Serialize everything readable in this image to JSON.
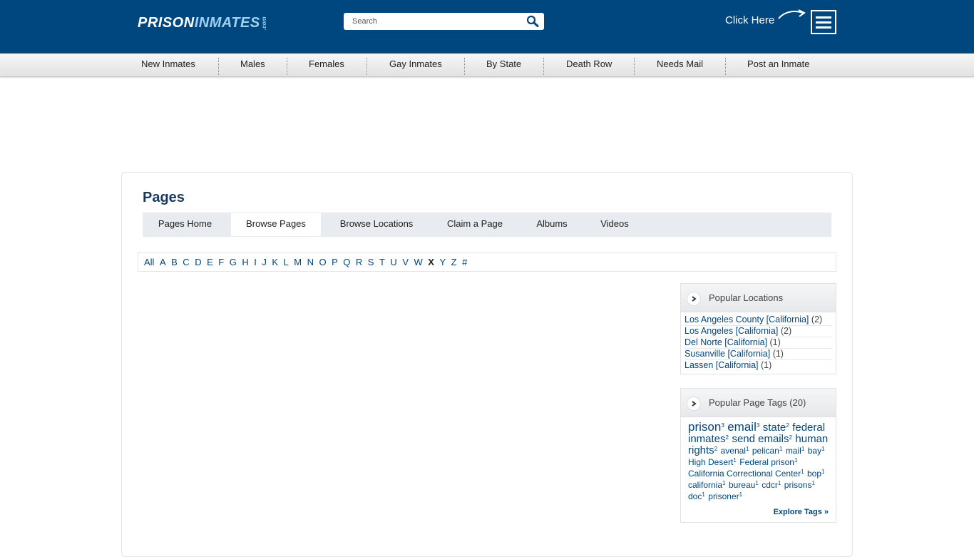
{
  "header": {
    "logo_part1": "PRISON",
    "logo_part2": "INMATES",
    "logo_suffix": ".com",
    "search_placeholder": "Search",
    "click_here": "Click Here"
  },
  "nav": {
    "items": [
      "New Inmates",
      "Males",
      "Females",
      "Gay Inmates",
      "By State",
      "Death Row",
      "Needs Mail",
      "Post an Inmate"
    ]
  },
  "page": {
    "title": "Pages",
    "tabs": [
      "Pages Home",
      "Browse Pages",
      "Browse Locations",
      "Claim a Page",
      "Albums",
      "Videos"
    ],
    "active_tab": "Browse Pages"
  },
  "alphabet": {
    "letters": [
      "All",
      "A",
      "B",
      "C",
      "D",
      "E",
      "F",
      "G",
      "H",
      "I",
      "J",
      "K",
      "L",
      "M",
      "N",
      "O",
      "P",
      "Q",
      "R",
      "S",
      "T",
      "U",
      "V",
      "W",
      "X",
      "Y",
      "Z",
      "#"
    ],
    "current": "X"
  },
  "popular_locations": {
    "title": "Popular Locations",
    "items": [
      {
        "name": "Los Angeles County [California]",
        "count": "(2)"
      },
      {
        "name": "Los Angeles [California]",
        "count": "(2)"
      },
      {
        "name": "Del Norte [California]",
        "count": "(1)"
      },
      {
        "name": "Susanville [California]",
        "count": "(1)"
      },
      {
        "name": "Lassen [California]",
        "count": "(1)"
      }
    ]
  },
  "popular_tags": {
    "title": "Popular Page Tags (20)",
    "tags": [
      {
        "name": "prison",
        "count": "3",
        "size": 17
      },
      {
        "name": "email",
        "count": "3",
        "size": 17
      },
      {
        "name": "state",
        "count": "2",
        "size": 15
      },
      {
        "name": "federal inmates",
        "count": "2",
        "size": 15
      },
      {
        "name": "send emails",
        "count": "2",
        "size": 15
      },
      {
        "name": "human rights",
        "count": "2",
        "size": 15
      },
      {
        "name": "avenal",
        "count": "1",
        "size": 12
      },
      {
        "name": "pelican",
        "count": "1",
        "size": 12
      },
      {
        "name": "mail",
        "count": "1",
        "size": 12
      },
      {
        "name": "bay",
        "count": "1",
        "size": 12
      },
      {
        "name": "High Desert",
        "count": "1",
        "size": 12
      },
      {
        "name": "Federal prison",
        "count": "1",
        "size": 12
      },
      {
        "name": "California Correctional Center",
        "count": "1",
        "size": 12
      },
      {
        "name": "bop",
        "count": "1",
        "size": 12
      },
      {
        "name": "california",
        "count": "1",
        "size": 12
      },
      {
        "name": "bureau",
        "count": "1",
        "size": 12
      },
      {
        "name": "cdcr",
        "count": "1",
        "size": 12
      },
      {
        "name": "prisons",
        "count": "1",
        "size": 12
      },
      {
        "name": "doc",
        "count": "1",
        "size": 12
      },
      {
        "name": "prisoner",
        "count": "1",
        "size": 12
      }
    ],
    "explore_label": "Explore Tags »"
  }
}
